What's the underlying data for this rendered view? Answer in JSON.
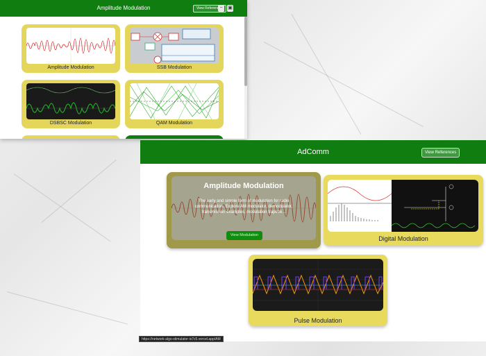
{
  "back_window": {
    "title": "Amplitude Modulation",
    "references_label": "View References",
    "minimize_glyph": "−",
    "maximize_glyph": "▣",
    "cards": [
      {
        "label": "Amplitude Modulation"
      },
      {
        "label": "SSB Modulation"
      },
      {
        "label": "DSBSC Modulation"
      },
      {
        "label": "QAM Modulation"
      }
    ]
  },
  "front_window": {
    "title": "AdComm",
    "references_label": "View References",
    "cards": [
      {
        "label": "Amplitude Modulation",
        "overlay_title": "Amplitude Modulation",
        "description": "The early and simple form of modulation for radio communication. Explore AM modulator, demodulator, transmission examples, modulation trapeze...",
        "button_label": "View Modulation"
      },
      {
        "label": "Digital Modulation"
      },
      {
        "label": "Pulse Modulation"
      }
    ]
  },
  "status_url": "https://network-algo-stimulator-is7c5.vercel.app/AM"
}
